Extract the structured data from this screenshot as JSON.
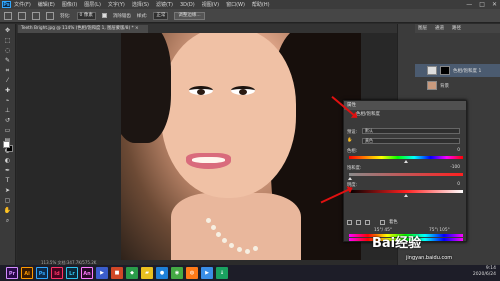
{
  "app": {
    "logo": "Ps"
  },
  "menubar": {
    "items": [
      "文件(F)",
      "编辑(E)",
      "图像(I)",
      "图层(L)",
      "文字(Y)",
      "选择(S)",
      "滤镜(T)",
      "3D(D)",
      "视图(V)",
      "窗口(W)",
      "帮助(H)"
    ]
  },
  "window_controls": {
    "minimize": "—",
    "maximize": "□",
    "close": "✕"
  },
  "options_bar": {
    "feather_label": "羽化:",
    "feather_value": "0 像素",
    "antialias_label": "消除锯齿",
    "style_label": "样式:",
    "style_value": "正常",
    "refine_button": "调整边缘..."
  },
  "document": {
    "tab_title": "Teeth Bright.jpg @ 114% (色相/饱和度 1, 图层蒙版/8) * ×",
    "status": "113.5%  文档:347.7K/575.2K"
  },
  "layers": {
    "tabs": [
      "图层",
      "通道",
      "路径"
    ],
    "rows": [
      {
        "name": "色相/饱和度 1"
      },
      {
        "name": "背景"
      }
    ]
  },
  "properties": {
    "title": "属性",
    "subtitle": "色相/饱和度",
    "preset_label": "预设:",
    "preset_value": "默认",
    "channel_value": "黄色",
    "hue_label": "色相:",
    "hue_value": "0",
    "saturation_label": "饱和度:",
    "saturation_value": "-100",
    "lightness_label": "明度:",
    "lightness_value": "0",
    "colorize_label": "着色",
    "range_left": "15°/ 45°",
    "range_right": "75°\\ 105°"
  },
  "taskbar": {
    "apps": [
      {
        "label": "Pr",
        "color": "#2a0a4a"
      },
      {
        "label": "Ai",
        "color": "#3a1a00"
      },
      {
        "label": "Ps",
        "color": "#0c2a4a"
      },
      {
        "label": "Id",
        "color": "#49021f"
      },
      {
        "label": "Lr",
        "color": "#0a2a3a"
      },
      {
        "label": "An",
        "color": "#2a0a2a"
      }
    ]
  },
  "clock": {
    "time": "9:14",
    "date": "2020/6/24"
  },
  "watermark": {
    "brand": "Bai经验",
    "url": "jingyan.baidu.com"
  },
  "colors": {
    "accent": "#31a8ff",
    "arrow": "#e01010",
    "selected_layer": "#4b5b70"
  }
}
